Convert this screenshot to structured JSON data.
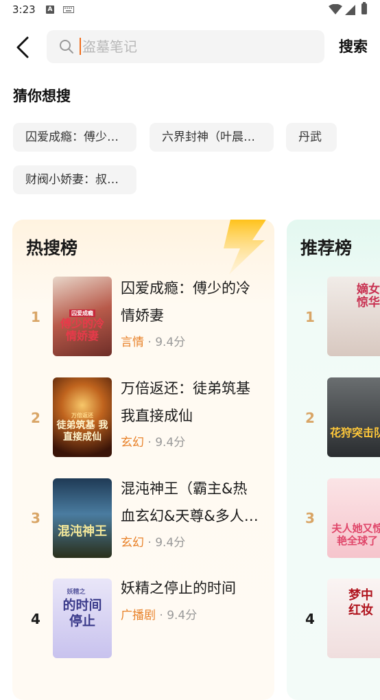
{
  "status": {
    "time": "3:23",
    "a_icon": "A"
  },
  "search": {
    "placeholder": "盗墓笔记",
    "button": "搜索"
  },
  "guess": {
    "title": "猜你想搜",
    "chips": [
      "囚爱成瘾：傅少…",
      "六界封神（叶晨…",
      "丹武",
      "财阀小娇妻：叔…"
    ]
  },
  "hot": {
    "title": "热搜榜",
    "items": [
      {
        "rank": "1",
        "title": "囚爱成瘾：傅少的冷情娇妻",
        "genre": "言情",
        "score": " · 9.4分",
        "cover_text": "傅少的冷情娇妻",
        "cover_sub": "囚爱成瘾"
      },
      {
        "rank": "2",
        "title": "万倍返还：徒弟筑基我直接成仙",
        "genre": "玄幻",
        "score": " · 9.4分",
        "cover_text": "徒弟筑基 我直接成仙",
        "cover_sub": "万倍返还"
      },
      {
        "rank": "3",
        "title": "混沌神王（霸主&热血玄幻&天尊&多人…",
        "genre": "玄幻",
        "score": " · 9.4分",
        "cover_text": "混沌神王",
        "cover_sub": ""
      },
      {
        "rank": "4",
        "title": "妖精之停止的时间",
        "genre": "广播剧",
        "score": " · 9.4分",
        "cover_text": "的时间 停止",
        "cover_sub": "妖精之"
      }
    ]
  },
  "recommend": {
    "title": "推荐榜",
    "items": [
      {
        "rank": "1",
        "cover_text": "嫡女惊华"
      },
      {
        "rank": "2",
        "cover_text": "花狩突击队"
      },
      {
        "rank": "3",
        "cover_text": "夫人她又惊艳全球了"
      },
      {
        "rank": "4",
        "cover_text": "梦中红妆"
      }
    ]
  },
  "colors": {
    "accent": "#ef6c1a",
    "genre": "#e8822a",
    "rank_gold": "#d9a566"
  }
}
